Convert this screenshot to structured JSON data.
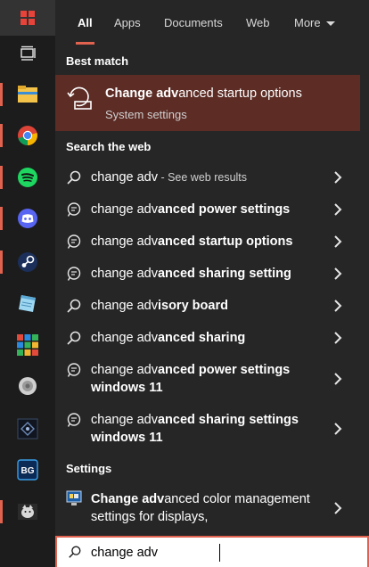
{
  "tabs": [
    {
      "label": "All",
      "active": true
    },
    {
      "label": "Apps"
    },
    {
      "label": "Documents"
    },
    {
      "label": "Web"
    },
    {
      "label": "More"
    }
  ],
  "sections": {
    "best_match": "Best match",
    "search_web": "Search the web",
    "settings": "Settings"
  },
  "best_match": {
    "title_bold": "Change adv",
    "title_rest": "anced startup options",
    "subtitle": "System settings",
    "icon": "startup-recovery-icon"
  },
  "web_results": [
    {
      "pre": "change adv",
      "bold": "",
      "hint": " - See web results",
      "icon": "search-icon"
    },
    {
      "pre": "change adv",
      "bold": "anced power settings",
      "icon": "search-suggestion-icon"
    },
    {
      "pre": "change adv",
      "bold": "anced startup options",
      "icon": "search-suggestion-icon"
    },
    {
      "pre": "change adv",
      "bold": "anced sharing setting",
      "icon": "search-suggestion-icon"
    },
    {
      "pre": "change adv",
      "bold": "isory board",
      "icon": "search-icon"
    },
    {
      "pre": "change adv",
      "bold": "anced sharing",
      "icon": "search-icon"
    },
    {
      "pre": "change adv",
      "bold": "anced power settings windows 11",
      "icon": "search-suggestion-icon"
    },
    {
      "pre": "change adv",
      "bold": "anced sharing settings windows 11",
      "icon": "search-suggestion-icon"
    }
  ],
  "settings_results": [
    {
      "bold": "Change adv",
      "rest": "anced color management settings for displays,",
      "icon": "display-color-icon"
    }
  ],
  "search": {
    "value": "change adv"
  },
  "taskbar": {
    "start": "windows-start-icon",
    "task_view": "task-view-icon",
    "apps": [
      {
        "name": "file-explorer",
        "running": true
      },
      {
        "name": "chrome",
        "running": true
      },
      {
        "name": "spotify",
        "running": true
      },
      {
        "name": "discord",
        "running": true
      },
      {
        "name": "steam",
        "running": true
      },
      {
        "name": "notepad-app",
        "running": false
      },
      {
        "name": "grid-app",
        "running": false
      },
      {
        "name": "speaker-app",
        "running": false
      },
      {
        "name": "dark-app",
        "running": false
      },
      {
        "name": "bg-app",
        "running": false
      },
      {
        "name": "cat-app",
        "running": true
      }
    ]
  },
  "colors": {
    "accent": "#e0624f",
    "best_match_bg": "#5c2c25",
    "panel_bg": "#262626",
    "taskbar_bg": "#1c1c1c"
  }
}
